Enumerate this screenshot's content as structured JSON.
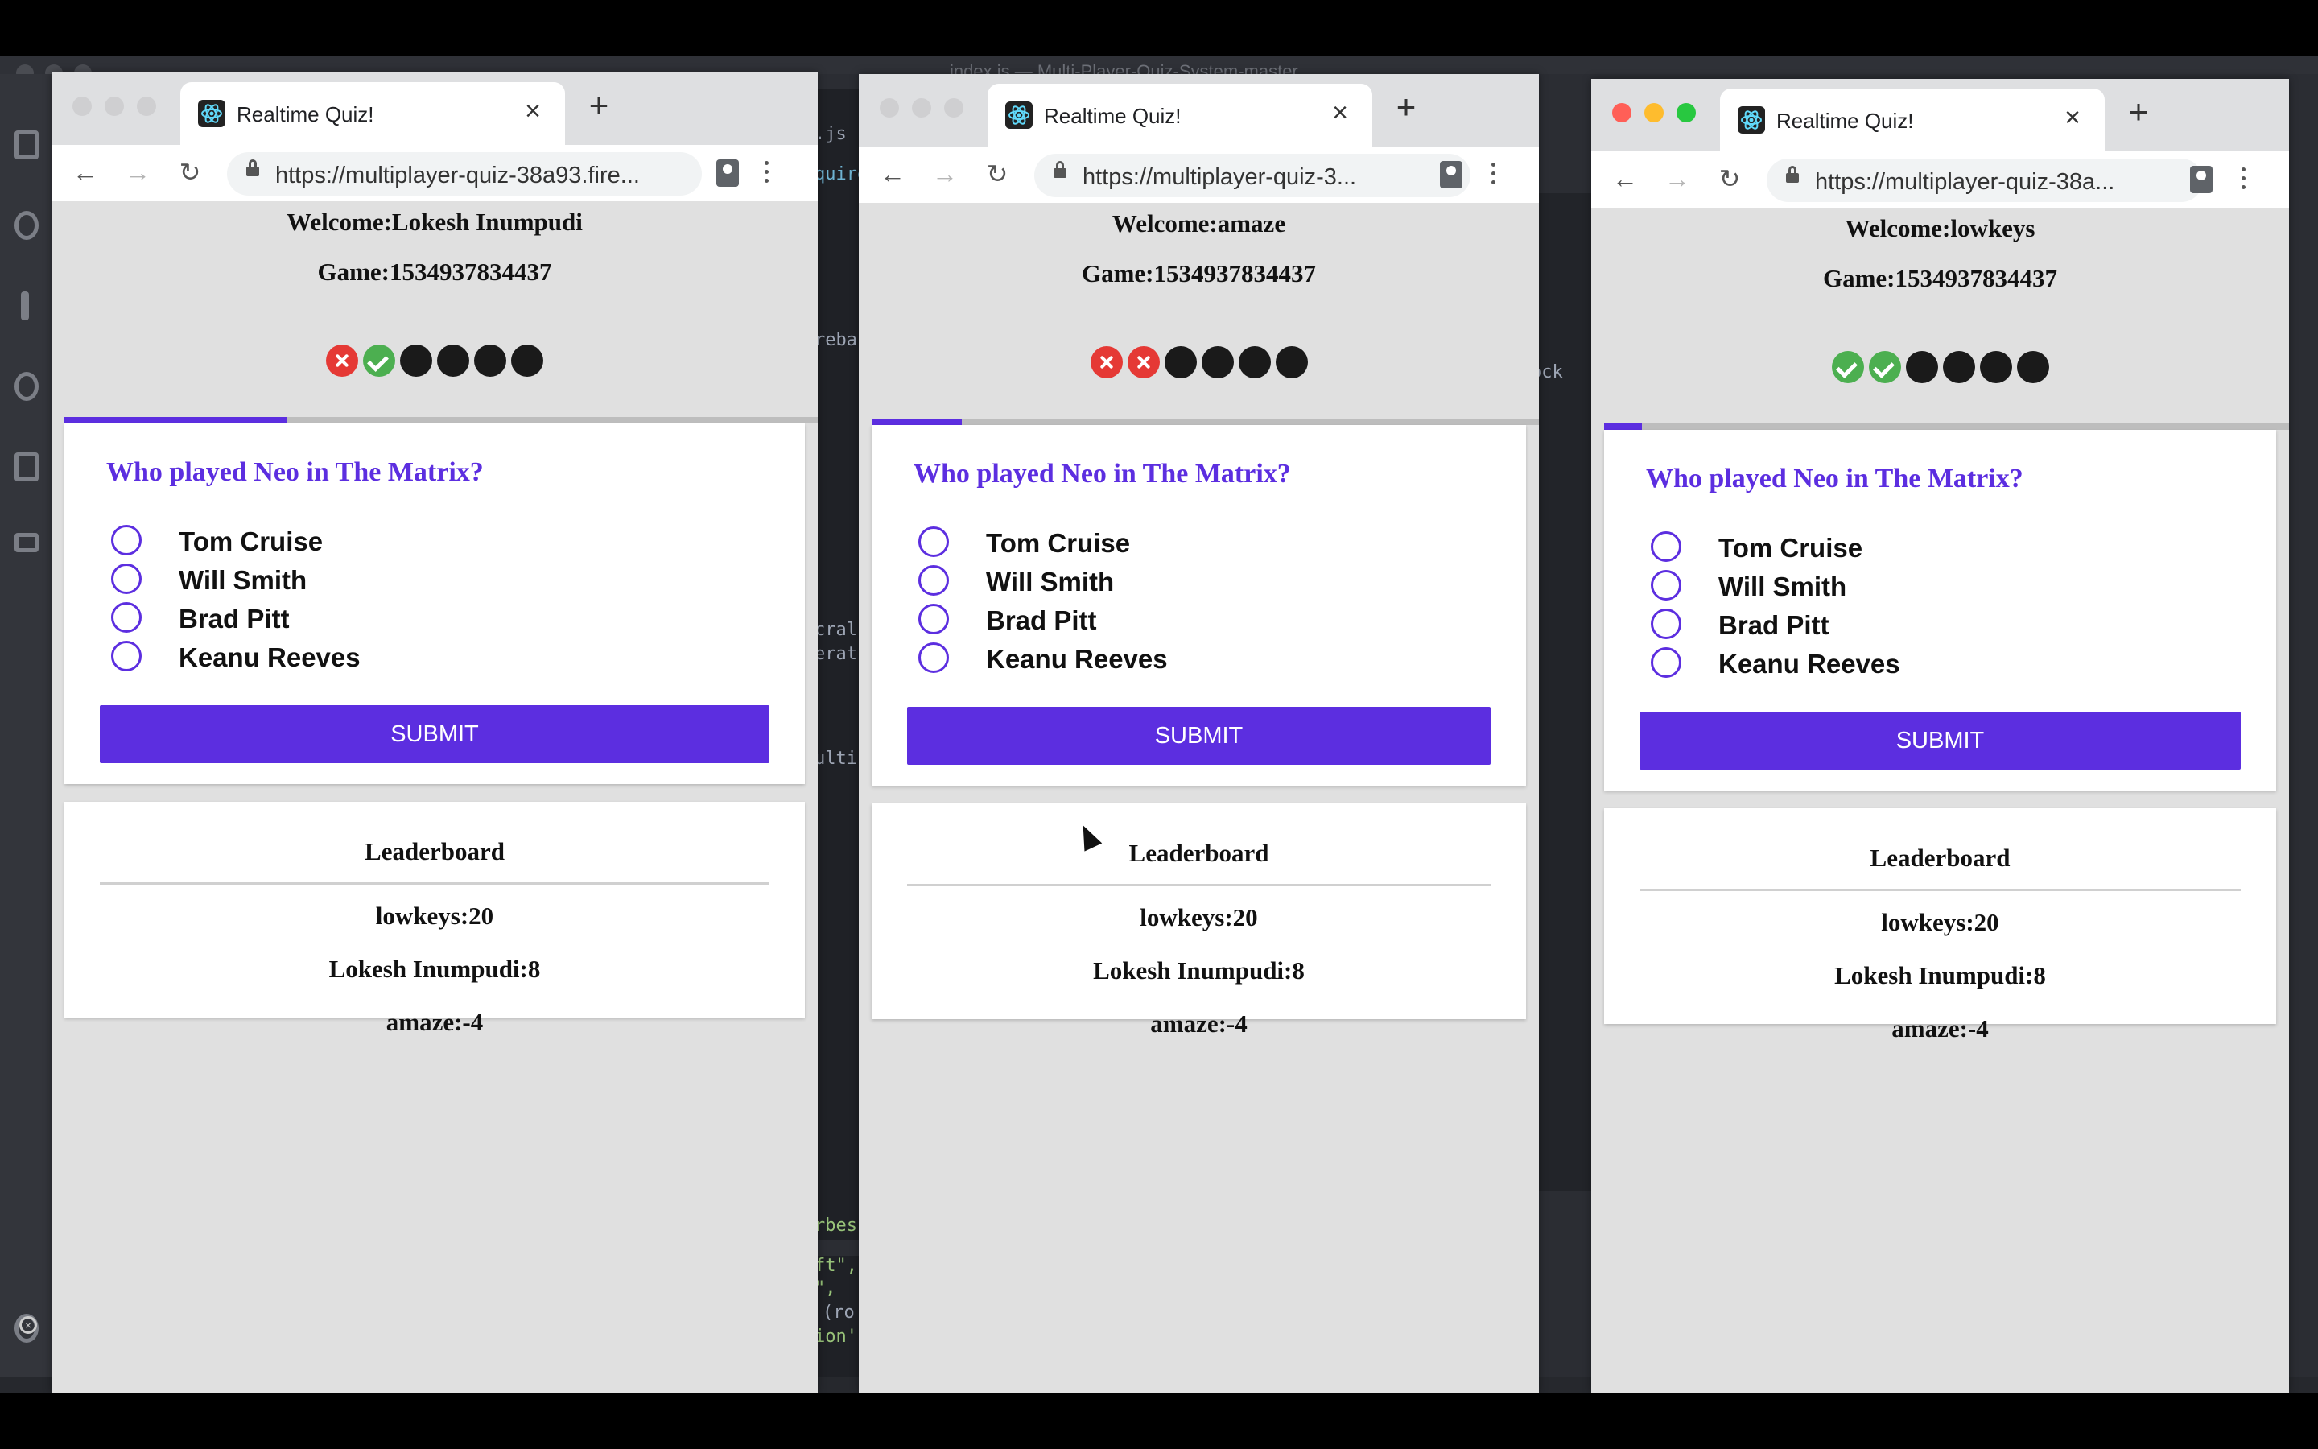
{
  "editor": {
    "title": "index.js — Multi-Player-Quiz-System-master",
    "fragments": [
      ".js",
      "quire",
      "reba",
      "ock",
      "cral",
      "erat",
      "ulti",
      "rbes",
      "ft\",",
      "\",",
      "(ro",
      "ion'"
    ]
  },
  "colors": {
    "accent": "#5c2ee0",
    "wrong": "#e53935",
    "right": "#4caf50",
    "pending": "#1a1a1a"
  },
  "windows": [
    {
      "tab_title": "Realtime Quiz!",
      "url": "https://multiplayer-quiz-38a93.fire...",
      "welcome": "Welcome:Lokesh Inumpudi",
      "game": "Game:1534937834437",
      "results": [
        "wrong",
        "right",
        "pending",
        "pending",
        "pending",
        "pending"
      ],
      "progress": 0.295,
      "question": "Who played Neo in The Matrix?",
      "options": [
        "Tom Cruise",
        "Will Smith",
        "Brad Pitt",
        "Keanu Reeves"
      ],
      "submit_label": "SUBMIT",
      "leaderboard_title": "Leaderboard",
      "leaderboard": [
        "lowkeys:20",
        "Lokesh Inumpudi:8",
        "amaze:-4"
      ]
    },
    {
      "tab_title": "Realtime Quiz!",
      "url": "https://multiplayer-quiz-3...",
      "welcome": "Welcome:amaze",
      "game": "Game:1534937834437",
      "results": [
        "wrong",
        "wrong",
        "pending",
        "pending",
        "pending",
        "pending"
      ],
      "progress": 0.135,
      "question": "Who played Neo in The Matrix?",
      "options": [
        "Tom Cruise",
        "Will Smith",
        "Brad Pitt",
        "Keanu Reeves"
      ],
      "submit_label": "SUBMIT",
      "leaderboard_title": "Leaderboard",
      "leaderboard": [
        "lowkeys:20",
        "Lokesh Inumpudi:8",
        "amaze:-4"
      ]
    },
    {
      "tab_title": "Realtime Quiz!",
      "url": "https://multiplayer-quiz-38a...",
      "welcome": "Welcome:lowkeys",
      "game": "Game:1534937834437",
      "results": [
        "right",
        "right",
        "pending",
        "pending",
        "pending",
        "pending"
      ],
      "progress": 0.055,
      "question": "Who played Neo in The Matrix?",
      "options": [
        "Tom Cruise",
        "Will Smith",
        "Brad Pitt",
        "Keanu Reeves"
      ],
      "submit_label": "SUBMIT",
      "leaderboard_title": "Leaderboard",
      "leaderboard": [
        "lowkeys:20",
        "Lokesh Inumpudi:8",
        "amaze:-4"
      ]
    }
  ]
}
